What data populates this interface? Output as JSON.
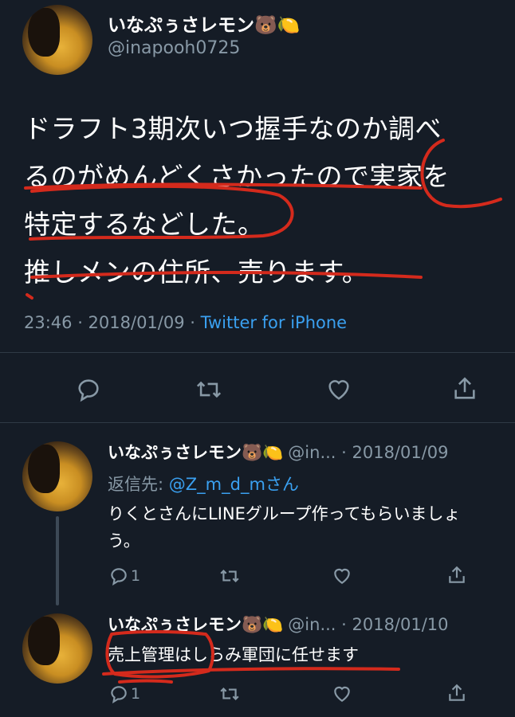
{
  "main_tweet": {
    "display_name": "いなぷぅさレモン",
    "name_emoji": "🐻🍋",
    "handle": "@inapooh0725",
    "lines": [
      "ドラフト3期次いつ握手なのか調べ",
      "るのがめんどくさかったので実家を",
      "特定するなどした。",
      "推しメンの住所、売ります。"
    ],
    "time": "23:46 · 2018/01/09 · ",
    "client": "Twitter for iPhone"
  },
  "reply1": {
    "display_name": "いなぷぅさレモン",
    "name_emoji": "🐻🍋",
    "handle_date": "@in... · 2018/01/09",
    "reply_to_prefix": "返信先: ",
    "reply_to_handle": "@Z_m_d_mさん",
    "lines": [
      "りくとさんにLINEグループ作ってもらいましょ",
      "う。"
    ],
    "reply_count": "1"
  },
  "reply2": {
    "display_name": "いなぷぅさレモン",
    "name_emoji": "🐻🍋",
    "handle_date": "@in... · 2018/01/10",
    "text": "売上管理はしらみ軍団に任せます",
    "reply_count": "1"
  },
  "colors": {
    "background": "#151c26",
    "accent": "#3aa0f0",
    "muted": "#8899a6",
    "annotation": "#d42a1c"
  }
}
